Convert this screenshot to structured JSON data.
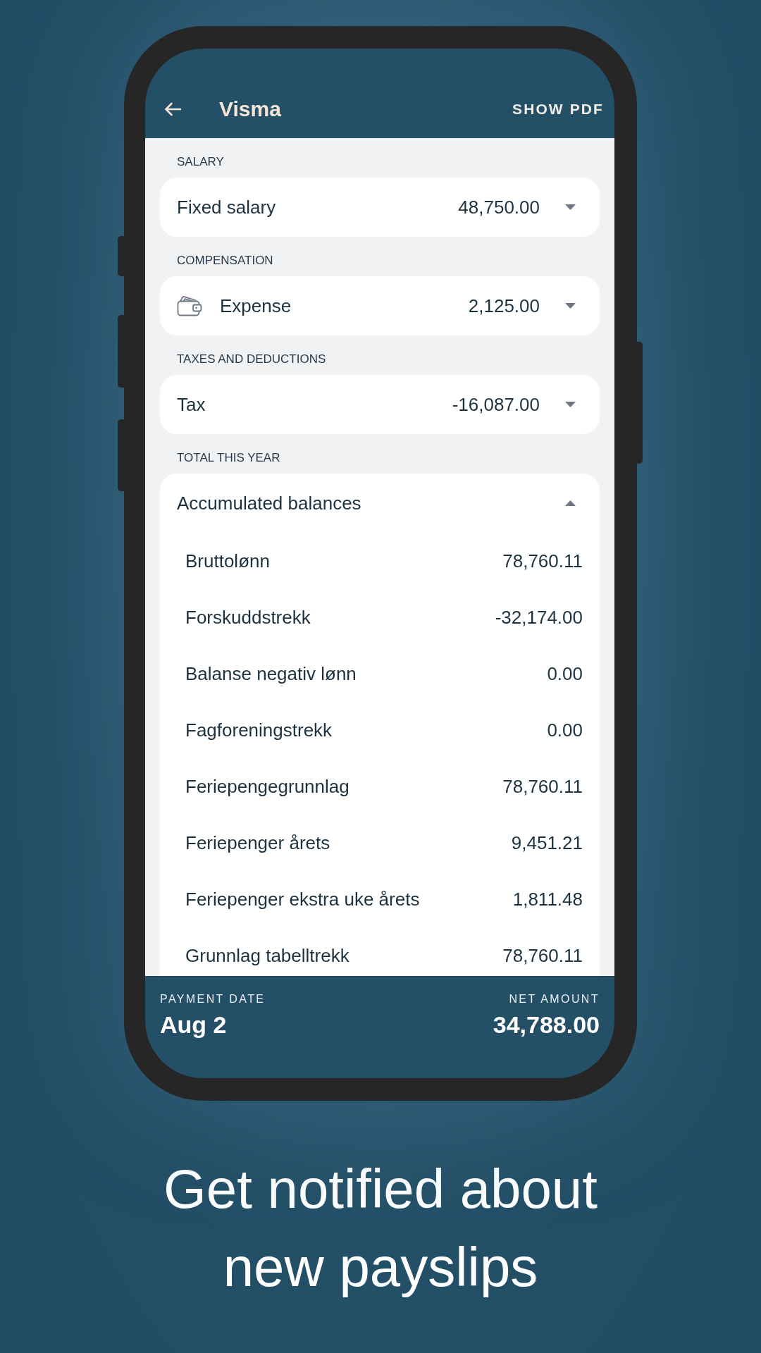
{
  "header": {
    "title": "Visma",
    "action": "SHOW PDF"
  },
  "sections": [
    {
      "label": "SALARY",
      "card": {
        "kind": "plain",
        "label": "Fixed salary",
        "amount": "48,750.00",
        "expanded": false
      }
    },
    {
      "label": "COMPENSATION",
      "card": {
        "kind": "iconed",
        "label": "Expense",
        "amount": "2,125.00",
        "expanded": false
      }
    },
    {
      "label": "TAXES AND DEDUCTIONS",
      "card": {
        "kind": "plain",
        "label": "Tax",
        "amount": "-16,087.00",
        "expanded": false
      }
    },
    {
      "label": "TOTAL THIS YEAR",
      "card": {
        "kind": "breakdown",
        "label": "Accumulated balances",
        "expanded": true,
        "rows": [
          {
            "label": "Bruttolønn",
            "value": "78,760.11"
          },
          {
            "label": "Forskuddstrekk",
            "value": "-32,174.00"
          },
          {
            "label": "Balanse negativ lønn",
            "value": "0.00"
          },
          {
            "label": "Fagforeningstrekk",
            "value": "0.00"
          },
          {
            "label": "Feriepengegrunnlag",
            "value": "78,760.11"
          },
          {
            "label": "Feriepenger årets",
            "value": "9,451.21"
          },
          {
            "label": "Feriepenger ekstra uke årets",
            "value": "1,811.48"
          },
          {
            "label": "Grunnlag tabelltrekk",
            "value": "78,760.11"
          }
        ]
      }
    }
  ],
  "footer": {
    "payment_date_label": "PAYMENT DATE",
    "payment_date": "Aug 2",
    "net_amount_label": "NET AMOUNT",
    "net_amount": "34,788.00"
  },
  "caption": "Get notified about new payslips"
}
